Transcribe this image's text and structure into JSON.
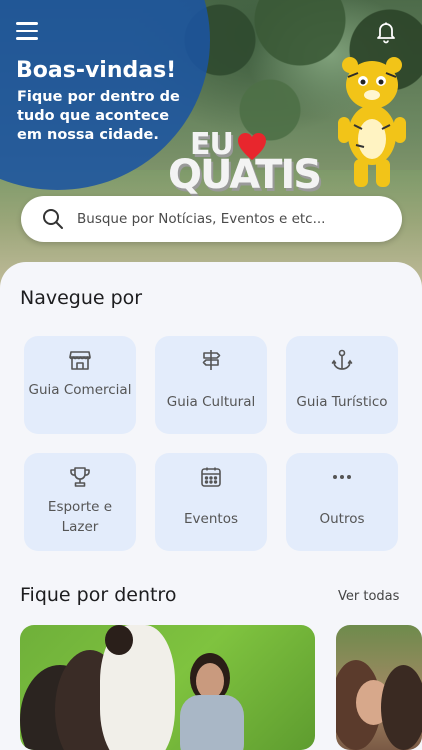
{
  "header": {
    "welcome_title": "Boas-vindas!",
    "welcome_subtitle": "Fique por dentro de tudo que acontece em nossa cidade.",
    "menu_icon": "hamburger-menu-icon",
    "notification_icon": "bell-icon",
    "sign_text_top": "EU",
    "sign_text_bottom": "QUATIS"
  },
  "search": {
    "placeholder": "Busque por Notícias, Eventos e etc...",
    "icon": "search-icon"
  },
  "navigate": {
    "title": "Navegue por",
    "categories": [
      {
        "label": "Guia Comercial",
        "icon": "storefront-icon"
      },
      {
        "label": "Guia Cultural",
        "icon": "signpost-icon"
      },
      {
        "label": "Guia Turístico",
        "icon": "anchor-icon"
      },
      {
        "label": "Esporte e Lazer",
        "icon": "trophy-icon"
      },
      {
        "label": "Eventos",
        "icon": "calendar-icon"
      },
      {
        "label": "Outros",
        "icon": "more-dots-icon"
      }
    ]
  },
  "news": {
    "title": "Fique por dentro",
    "see_all": "Ver todas"
  },
  "colors": {
    "brand_blue": "#1b54a0",
    "category_bg": "#e3ecfb",
    "icon_gray": "#555555"
  }
}
